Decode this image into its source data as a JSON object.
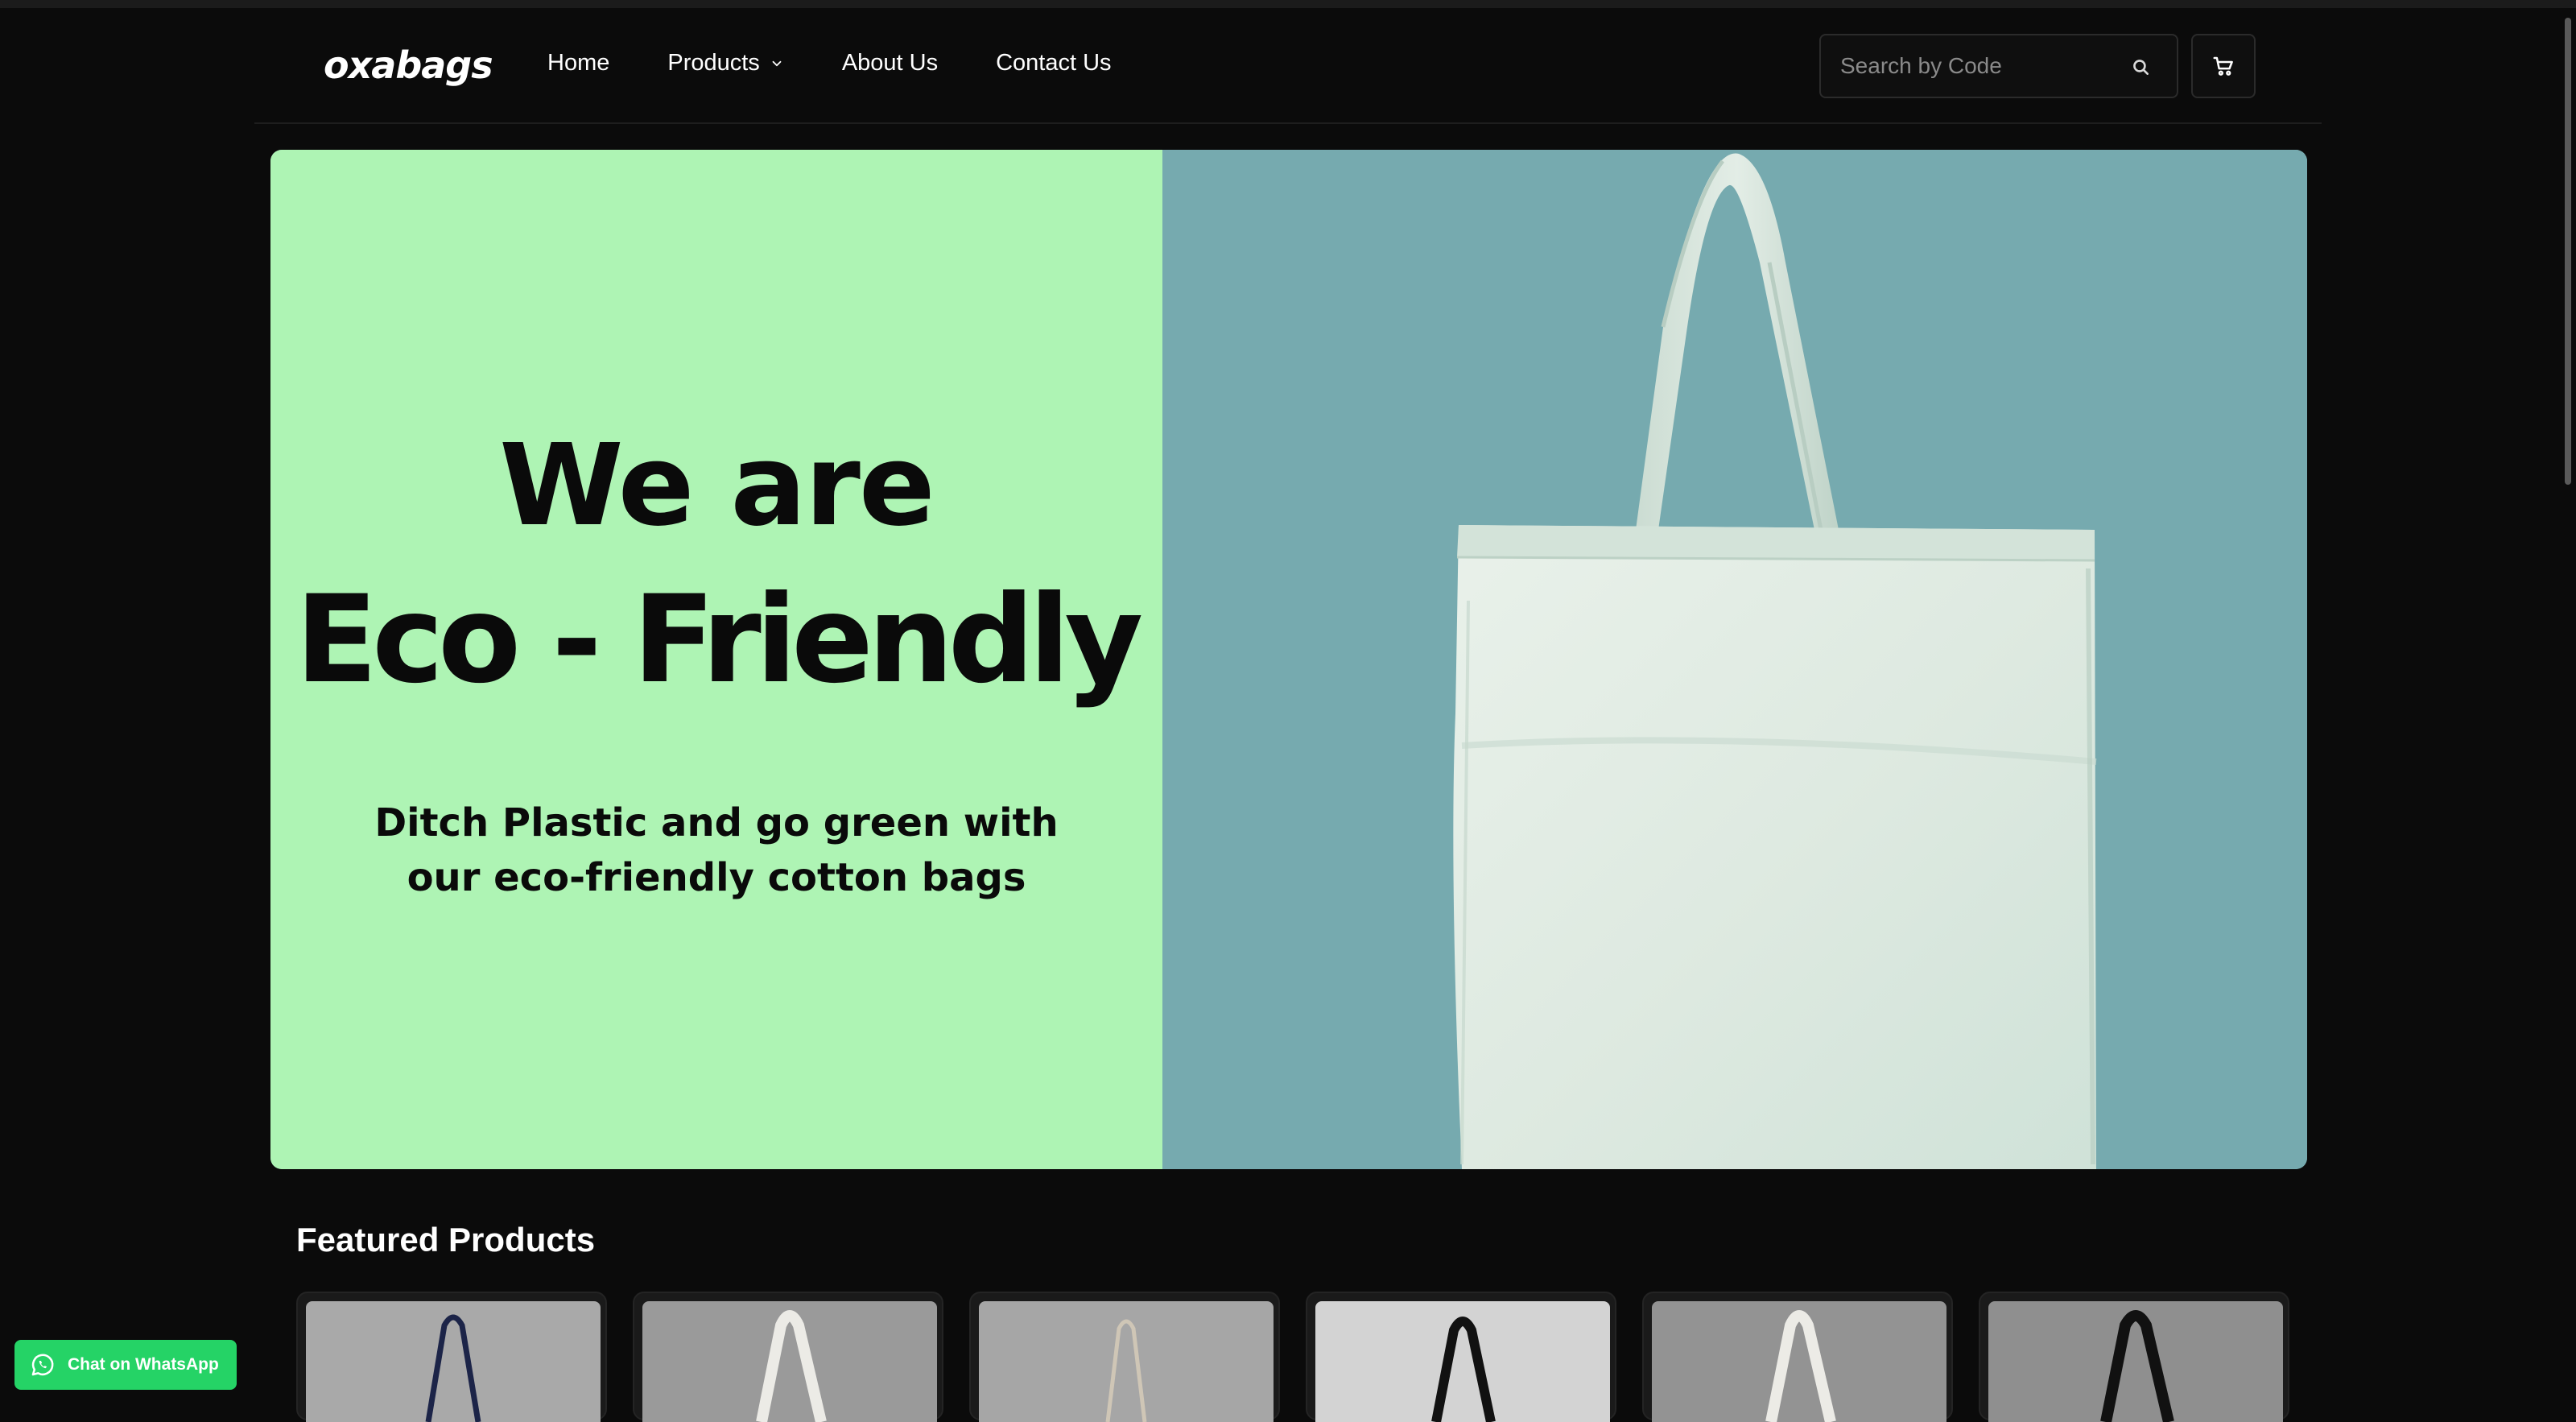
{
  "brand": {
    "logo_text": "oxabags"
  },
  "nav": {
    "items": [
      {
        "label": "Home"
      },
      {
        "label": "Products"
      },
      {
        "label": "About Us"
      },
      {
        "label": "Contact Us"
      }
    ]
  },
  "search": {
    "placeholder": "Search by Code"
  },
  "hero": {
    "line1": "We are",
    "line2": "Eco - Friendly",
    "subtitle": "Ditch Plastic and go green with our eco-friendly cotton bags",
    "left_color": "#aef4b4",
    "right_color": "#76aaaf"
  },
  "featured": {
    "title": "Featured Products",
    "products": [
      {
        "bg": "#a9a9a9",
        "handle": "#1c2448"
      },
      {
        "bg": "#9a9a9a",
        "handle": "#ecebe6"
      },
      {
        "bg": "#a6a6a6",
        "handle": "#cfc6b6"
      },
      {
        "bg": "#d3d3d3",
        "handle": "#111111"
      },
      {
        "bg": "#939393",
        "handle": "#ecebe6"
      },
      {
        "bg": "#8f8f8f",
        "handle": "#111111"
      }
    ]
  },
  "whatsapp": {
    "label": "Chat on WhatsApp",
    "color": "#25d366"
  },
  "icons": [
    "chevron-down-icon",
    "search-icon",
    "cart-icon",
    "whatsapp-icon"
  ]
}
